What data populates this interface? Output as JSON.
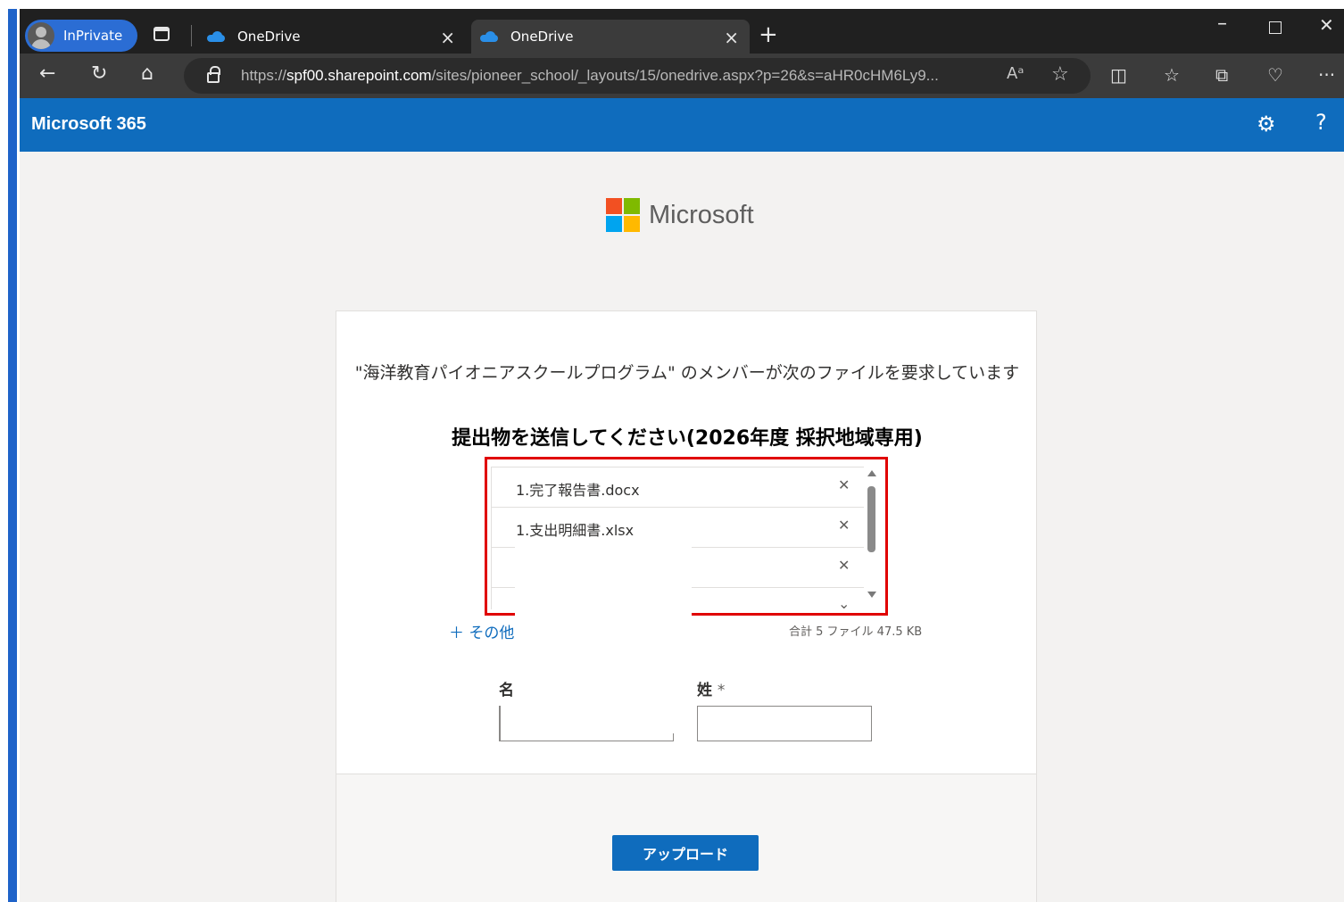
{
  "browser": {
    "profile_label": "InPrivate",
    "tabs": [
      {
        "title": "OneDrive",
        "active": false
      },
      {
        "title": "OneDrive",
        "active": true
      }
    ],
    "url_prefix": "https://",
    "url_host": "spf00.sharepoint.com",
    "url_path": "/sites/pioneer_school/_layouts/15/onedrive.aspx?p=26&s=aHR0cHM6Ly9...",
    "read_aloud_label": "Aᵃ"
  },
  "header": {
    "title": "Microsoft 365"
  },
  "logo": {
    "text": "Microsoft",
    "colors": [
      "#f25022",
      "#7fba00",
      "#00a4ef",
      "#ffb900"
    ]
  },
  "request": {
    "message": "\"海洋教育パイオニアスクールプログラム\" のメンバーが次のファイルを要求しています",
    "subject": "提出物を送信してください(2026年度 採択地域専用)"
  },
  "files": [
    {
      "name": "1.完了報告書.docx"
    },
    {
      "name": "1.支出明細書.xlsx"
    },
    {
      "name": ""
    },
    {
      "name": ""
    }
  ],
  "add_more_label": "＋ その他",
  "totals": "合計 5 ファイル  47.5 KB",
  "form": {
    "first_name_label": "名",
    "last_name_label": "姓",
    "required_mark": "*",
    "first_name_value": "",
    "last_name_value": ""
  },
  "upload_label": "アップロード",
  "colors": {
    "accent": "#0f6cbd",
    "highlight_box": "#e00000",
    "tab_bg": "#202020"
  }
}
